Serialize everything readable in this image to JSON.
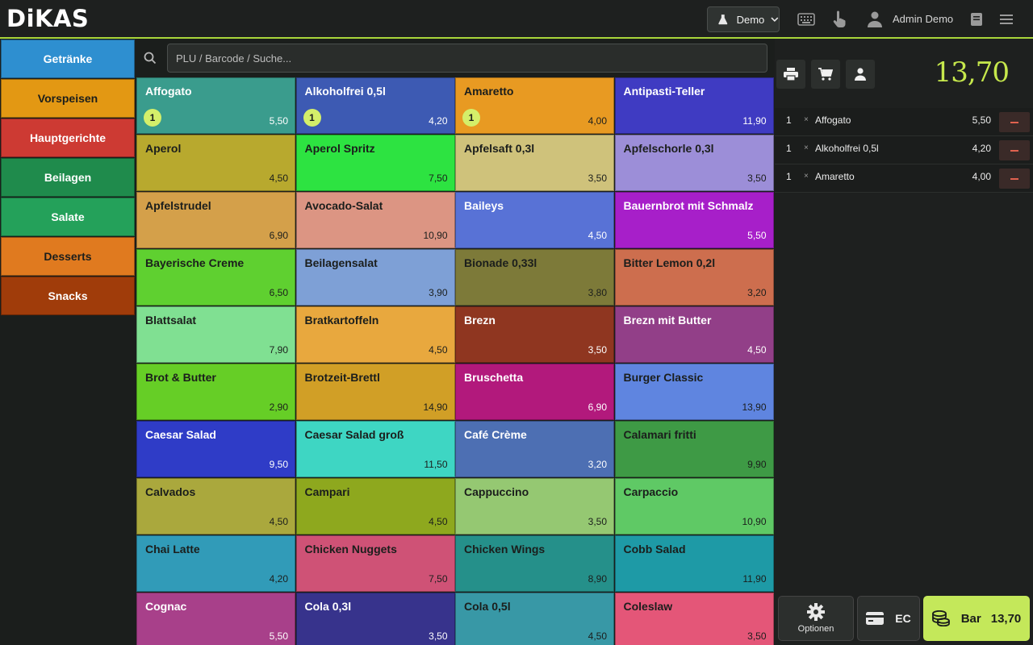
{
  "app": {
    "logo": "DiKAS"
  },
  "topbar": {
    "demo_label": "Demo",
    "user_name": "Admin Demo",
    "icons": [
      "flask-icon",
      "chevron-down-icon",
      "keyboard-icon",
      "pointer-hand-icon",
      "user-icon",
      "book-icon",
      "menu-icon"
    ]
  },
  "categories": [
    {
      "label": "Getränke",
      "color": "#2e8fd0"
    },
    {
      "label": "Vorspeisen",
      "color": "#e39813"
    },
    {
      "label": "Hauptgerichte",
      "color": "#cd3a33"
    },
    {
      "label": "Beilagen",
      "color": "#1f8b4c"
    },
    {
      "label": "Salate",
      "color": "#24a15a"
    },
    {
      "label": "Desserts",
      "color": "#e07a1f"
    },
    {
      "label": "Snacks",
      "color": "#a03c0a"
    }
  ],
  "search": {
    "placeholder": "PLU / Barcode / Suche..."
  },
  "products": [
    {
      "name": "Affogato",
      "price": "5,50",
      "color": "#3a9c8d",
      "badge": "1",
      "dark": false
    },
    {
      "name": "Alkoholfrei 0,5l",
      "price": "4,20",
      "color": "#3d5ab3",
      "badge": "1",
      "dark": false
    },
    {
      "name": "Amaretto",
      "price": "4,00",
      "color": "#e89a22",
      "badge": "1",
      "dark": true
    },
    {
      "name": "Antipasti-Teller",
      "price": "11,90",
      "color": "#3f3bc2",
      "badge": "",
      "dark": false
    },
    {
      "name": "Aperol",
      "price": "4,50",
      "color": "#b8a92e",
      "badge": "",
      "dark": true
    },
    {
      "name": "Aperol Spritz",
      "price": "7,50",
      "color": "#2de341",
      "badge": "",
      "dark": true
    },
    {
      "name": "Apfelsaft 0,3l",
      "price": "3,50",
      "color": "#cfc27b",
      "badge": "",
      "dark": true
    },
    {
      "name": "Apfelschorle 0,3l",
      "price": "3,50",
      "color": "#9c8ed8",
      "badge": "",
      "dark": true
    },
    {
      "name": "Apfelstrudel",
      "price": "6,90",
      "color": "#d4a04a",
      "badge": "",
      "dark": true
    },
    {
      "name": "Avocado-Salat",
      "price": "10,90",
      "color": "#dc9583",
      "badge": "",
      "dark": true
    },
    {
      "name": "Baileys",
      "price": "4,50",
      "color": "#5872d6",
      "badge": "",
      "dark": false
    },
    {
      "name": "Bauernbrot mit Schmalz",
      "price": "5,50",
      "color": "#a71fc9",
      "badge": "",
      "dark": false
    },
    {
      "name": "Bayerische Creme",
      "price": "6,50",
      "color": "#5fd030",
      "badge": "",
      "dark": true
    },
    {
      "name": "Beilagensalat",
      "price": "3,90",
      "color": "#7ea0d6",
      "badge": "",
      "dark": true
    },
    {
      "name": "Bionade 0,33l",
      "price": "3,80",
      "color": "#7d7a39",
      "badge": "",
      "dark": true
    },
    {
      "name": "Bitter Lemon 0,2l",
      "price": "3,20",
      "color": "#cd6e4e",
      "badge": "",
      "dark": true
    },
    {
      "name": "Blattsalat",
      "price": "7,90",
      "color": "#80e092",
      "badge": "",
      "dark": true
    },
    {
      "name": "Bratkartoffeln",
      "price": "4,50",
      "color": "#e8a83e",
      "badge": "",
      "dark": true
    },
    {
      "name": "Brezn",
      "price": "3,50",
      "color": "#8f3620",
      "badge": "",
      "dark": false
    },
    {
      "name": "Brezn mit Butter",
      "price": "4,50",
      "color": "#923f88",
      "badge": "",
      "dark": false
    },
    {
      "name": "Brot & Butter",
      "price": "2,90",
      "color": "#66ce26",
      "badge": "",
      "dark": true
    },
    {
      "name": "Brotzeit-Brettl",
      "price": "14,90",
      "color": "#d19f26",
      "badge": "",
      "dark": true
    },
    {
      "name": "Bruschetta",
      "price": "6,90",
      "color": "#b2197c",
      "badge": "",
      "dark": false
    },
    {
      "name": "Burger Classic",
      "price": "13,90",
      "color": "#5f85e0",
      "badge": "",
      "dark": true
    },
    {
      "name": "Caesar Salad",
      "price": "9,50",
      "color": "#2f3cc7",
      "badge": "",
      "dark": false
    },
    {
      "name": "Caesar Salad groß",
      "price": "11,50",
      "color": "#3ed6c3",
      "badge": "",
      "dark": true
    },
    {
      "name": "Café Crème",
      "price": "3,20",
      "color": "#4d6fb3",
      "badge": "",
      "dark": false
    },
    {
      "name": "Calamari fritti",
      "price": "9,90",
      "color": "#3e9a45",
      "badge": "",
      "dark": true
    },
    {
      "name": "Calvados",
      "price": "4,50",
      "color": "#aaa83d",
      "badge": "",
      "dark": true
    },
    {
      "name": "Campari",
      "price": "4,50",
      "color": "#8ea81e",
      "badge": "",
      "dark": true
    },
    {
      "name": "Cappuccino",
      "price": "3,50",
      "color": "#95c872",
      "badge": "",
      "dark": true
    },
    {
      "name": "Carpaccio",
      "price": "10,90",
      "color": "#5fc965",
      "badge": "",
      "dark": true
    },
    {
      "name": "Chai Latte",
      "price": "4,20",
      "color": "#319bb8",
      "badge": "",
      "dark": true
    },
    {
      "name": "Chicken Nuggets",
      "price": "7,50",
      "color": "#cf5276",
      "badge": "",
      "dark": true
    },
    {
      "name": "Chicken Wings",
      "price": "8,90",
      "color": "#25908a",
      "badge": "",
      "dark": true
    },
    {
      "name": "Cobb Salad",
      "price": "11,90",
      "color": "#1e9aa6",
      "badge": "",
      "dark": true
    },
    {
      "name": "Cognac",
      "price": "5,50",
      "color": "#a8408a",
      "badge": "",
      "dark": false
    },
    {
      "name": "Cola 0,3l",
      "price": "3,50",
      "color": "#37338c",
      "badge": "",
      "dark": false
    },
    {
      "name": "Cola 0,5l",
      "price": "4,50",
      "color": "#3898a6",
      "badge": "",
      "dark": true
    },
    {
      "name": "Coleslaw",
      "price": "3,50",
      "color": "#e45678",
      "badge": "",
      "dark": true
    }
  ],
  "cart": {
    "total": "13,70",
    "icons": [
      "printer-icon",
      "cart-icon",
      "user-icon"
    ],
    "items": [
      {
        "qty": "1",
        "x": "×",
        "name": "Affogato",
        "price": "5,50"
      },
      {
        "qty": "1",
        "x": "×",
        "name": "Alkoholfrei 0,5l",
        "price": "4,20"
      },
      {
        "qty": "1",
        "x": "×",
        "name": "Amaretto",
        "price": "4,00"
      }
    ]
  },
  "payment": {
    "options_label": "Optionen",
    "ec_label": "EC",
    "cash_label": "Bar",
    "cash_amount": "13,70"
  },
  "colors": {
    "accent": "#c4e85a",
    "total": "#c6e84c",
    "background": "#1b1e1c"
  }
}
